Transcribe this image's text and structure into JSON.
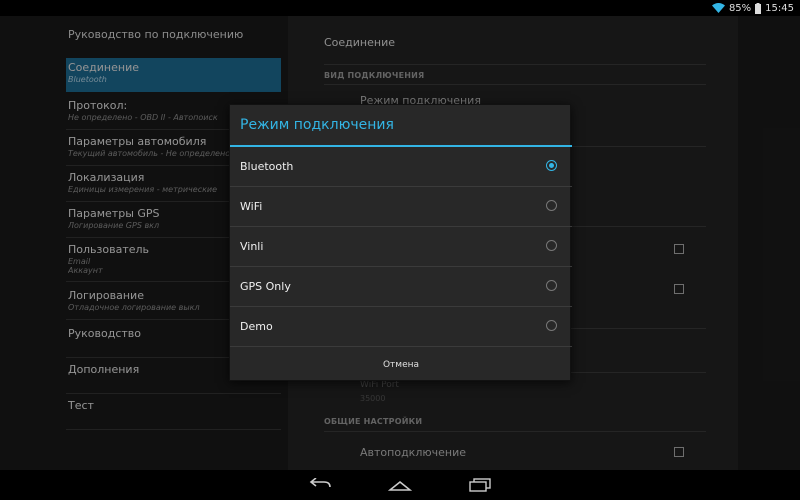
{
  "status_bar": {
    "battery_percent": "85%",
    "time": "15:45"
  },
  "left_pane": {
    "header": "Руководство по подключению",
    "items": [
      {
        "title": "Соединение",
        "sub": "Bluetooth",
        "selected": true
      },
      {
        "title": "Протокол:",
        "sub": "Не определено -    OBD II -    Автопоиск"
      },
      {
        "title": "Параметры автомобиля",
        "sub": "Текущий автомобиль - Не определено"
      },
      {
        "title": "Локализация",
        "sub": "Единицы измерения - метрические"
      },
      {
        "title": "Параметры GPS",
        "sub": "Логирование GPS вкл"
      },
      {
        "title": "Пользователь",
        "sub": "Email",
        "sub2": "Аккаунт"
      },
      {
        "title": "Логирование",
        "sub": "Отладочное логирование    выкл"
      },
      {
        "title": "Руководство"
      },
      {
        "title": "Дополнения"
      },
      {
        "title": "Тест"
      }
    ]
  },
  "right_pane": {
    "title": "Соединение",
    "section_connection": "ВИД ПОДКЛЮЧЕНИЯ",
    "connection_mode_item": "Режим подключения",
    "wifi_port": "WiFi Port",
    "wifi_port_value": "35000",
    "section_general": "ОБЩИЕ НАСТРОЙКИ",
    "autoconnect": "Автоподключение"
  },
  "dialog": {
    "title": "Режим подключения",
    "options": [
      {
        "label": "Bluetooth",
        "selected": true
      },
      {
        "label": "WiFi",
        "selected": false
      },
      {
        "label": "Vinli",
        "selected": false
      },
      {
        "label": "GPS Only",
        "selected": false
      },
      {
        "label": "Demo",
        "selected": false
      }
    ],
    "cancel": "Отмена"
  },
  "colors": {
    "accent": "#33b5e5",
    "selected_bg": "#1d6a91"
  }
}
